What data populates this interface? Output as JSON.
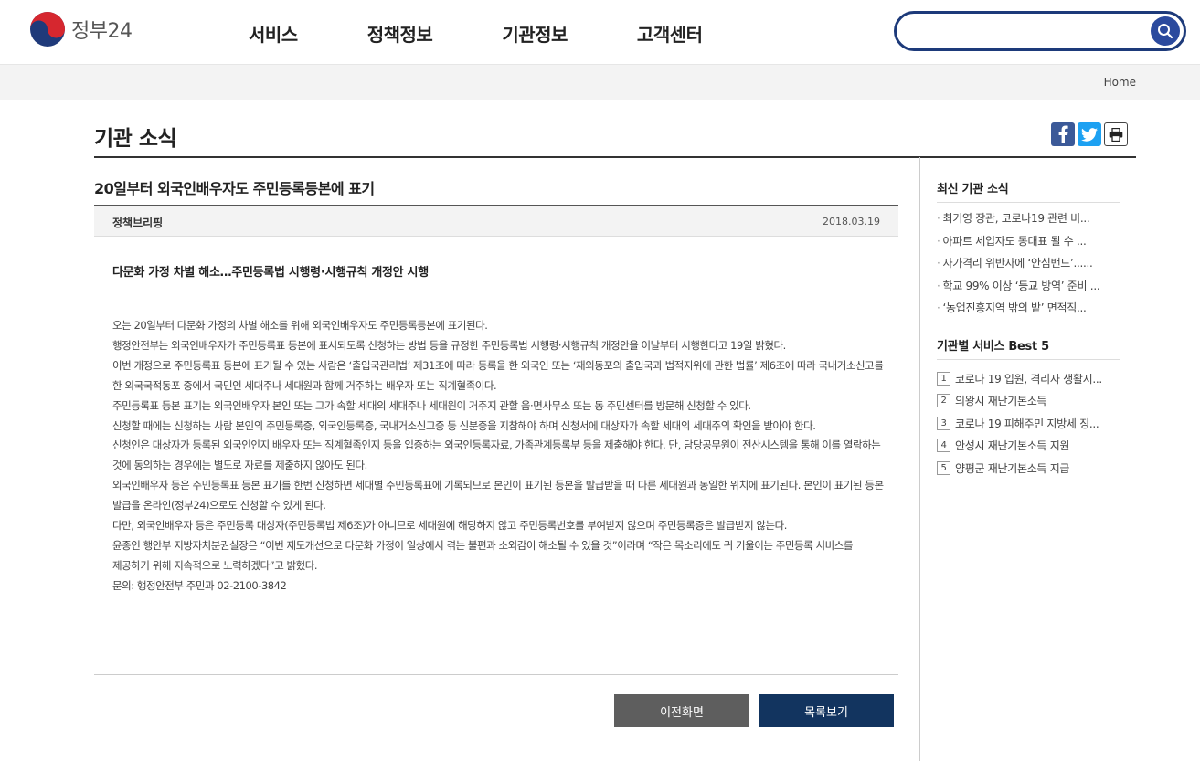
{
  "header": {
    "logo_text": "정부24",
    "nav": [
      "서비스",
      "정책정보",
      "기관정보",
      "고객센터"
    ],
    "search_placeholder": ""
  },
  "breadcrumb": {
    "home": "Home"
  },
  "page": {
    "title": "기관 소식"
  },
  "article": {
    "title": "20일부터 외국인배우자도 주민등록등본에 표기",
    "category": "정책브리핑",
    "date": "2018.03.19",
    "lead": "다문화 가정 차별 해소…주민등록법 시행령·시행규칙 개정안 시행",
    "paragraphs": [
      "오는 20일부터 다문화 가정의 차별 해소를 위해 외국인배우자도 주민등록등본에 표기된다.",
      "행정안전부는 외국인배우자가 주민등록표 등본에 표시되도록 신청하는 방법 등을 규정한 주민등록법 시행령·시행규칙 개정안을 이날부터 시행한다고 19일 밝혔다.",
      "이번 개정으로 주민등록표 등본에 표기될 수 있는 사람은 ‘출입국관리법’ 제31조에 따라 등록을 한 외국인 또는 ‘재외동포의 출입국과 법적지위에 관한 법률’ 제6조에 따라 국내거소신고를 한 외국국적동포 중에서 국민인 세대주나 세대원과 함께 거주하는 배우자 또는 직계혈족이다.",
      "주민등록표 등본 표기는 외국인배우자 본인 또는 그가 속할 세대의 세대주나 세대원이 거주지 관할 읍·면사무소 또는 동 주민센터를 방문해 신청할 수 있다.",
      "신청할 때에는 신청하는 사람 본인의 주민등록증, 외국인등록증, 국내거소신고증 등 신분증을 지참해야 하며 신청서에 대상자가 속할 세대의 세대주의 확인을 받아야 한다.",
      "신청인은 대상자가 등록된 외국인인지 배우자 또는 직계혈족인지 등을 입증하는 외국인등록자료, 가족관계등록부 등을 제출해야 한다. 단, 담당공무원이 전산시스템을 통해 이를 열람하는 것에 동의하는 경우에는 별도로 자료를 제출하지 않아도 된다.",
      "외국인배우자 등은 주민등록표 등본 표기를 한번 신청하면 세대별 주민등록표에 기록되므로 본인이 표기된 등본을 발급받을 때 다른 세대원과 동일한 위치에 표기된다. 본인이 표기된 등본 발급을 온라인(정부24)으로도 신청할 수 있게 된다.",
      "다만, 외국인배우자 등은 주민등록 대상자(주민등록법 제6조)가 아니므로 세대원에 해당하지 않고 주민등록번호를 부여받지 않으며 주민등록증은 발급받지 않는다.",
      "윤종인 행안부 지방자치분권실장은 “이번 제도개선으로 다문화 가정이 일상에서 겪는 불편과 소외감이 해소될 수 있을 것”이라며 “작은 목소리에도 귀 기울이는 주민등록 서비스를 제공하기 위해 지속적으로 노력하겠다”고 밝혔다.",
      "문의: 행정안전부 주민과 02-2100-3842"
    ]
  },
  "buttons": {
    "prev": "이전화면",
    "list": "목록보기"
  },
  "sidebar": {
    "news_title": "최신 기관 소식",
    "news": [
      "최기영 장관, 코로나19 관련 비...",
      "아파트 세입자도 동대표 될 수 ...",
      "자가격리 위반자에 ‘안심밴드’......",
      "학교 99% 이상 ‘등교 방역’ 준비 ...",
      "‘농업진흥지역 밖의 밭’ 면적직..."
    ],
    "best_title": "기관별 서비스 Best 5",
    "best": [
      {
        "num": "1",
        "label": "코로나 19 입원, 격리자 생활지..."
      },
      {
        "num": "2",
        "label": "의왕시 재난기본소득"
      },
      {
        "num": "3",
        "label": "코로나 19 피해주민 지방세 징..."
      },
      {
        "num": "4",
        "label": "안성시 재난기본소득 지원"
      },
      {
        "num": "5",
        "label": "양평군 재난기본소득 지급"
      }
    ]
  },
  "colors": {
    "brand_navy": "#12345f",
    "search_border": "#1d3a7a",
    "button_gray": "#5e5e5e"
  },
  "icons": {
    "search": "search-icon",
    "facebook": "facebook-icon",
    "twitter": "twitter-icon",
    "print": "print-icon"
  }
}
